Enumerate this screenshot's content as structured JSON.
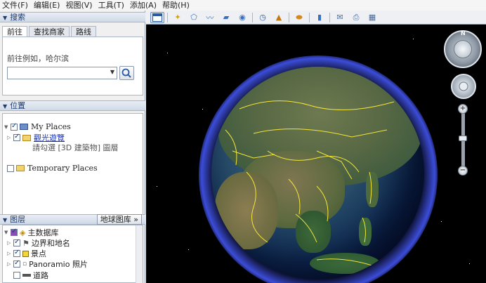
{
  "menu": [
    "文件(F)",
    "编辑(E)",
    "视图(V)",
    "工具(T)",
    "添加(A)",
    "帮助(H)"
  ],
  "search": {
    "header": "搜索",
    "tabs": [
      "前往",
      "查找商家",
      "路线"
    ],
    "hint": "前往例如，哈尔滨",
    "input_value": ""
  },
  "places": {
    "header": "位置",
    "my_places": "My Places",
    "sightseeing": "觀光遊覽",
    "sightseeing_note": "請勾選 [3D 建築物] 圖層",
    "temporary": "Temporary Places"
  },
  "layers": {
    "header": "图层",
    "gallery_button": "地球图库 »",
    "items": [
      "主数据库",
      "边界和地名",
      "景点",
      "Panoramio 照片",
      "道路"
    ]
  },
  "nav": {
    "north_label": "N",
    "zoom_in": "+",
    "zoom_out": "−"
  },
  "icons": {
    "toolbar": [
      "sidebar-toggle-icon",
      "placemark-icon",
      "polygon-icon",
      "path-icon",
      "image-overlay-icon",
      "record-tour-icon",
      "historical-imagery-icon",
      "sunlight-icon",
      "planets-icon",
      "ruler-icon",
      "email-icon",
      "print-icon",
      "view-in-maps-icon"
    ]
  },
  "colors": {
    "accent": "#1f3c6e",
    "border_lines": "#f5e63a"
  }
}
